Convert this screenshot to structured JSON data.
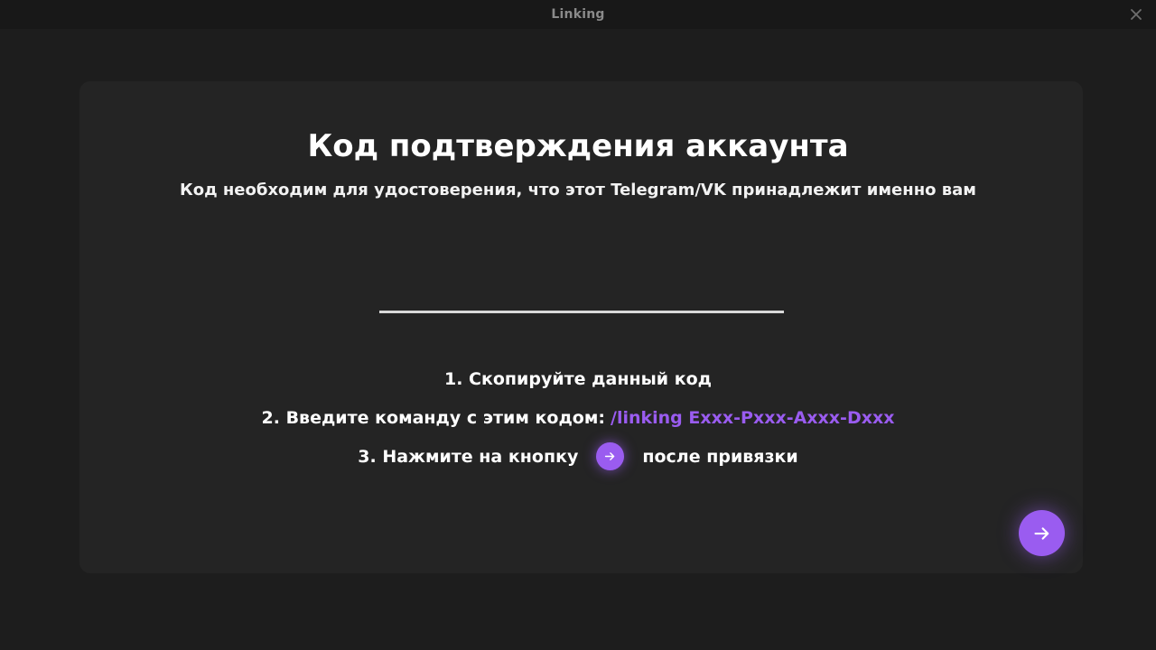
{
  "window": {
    "title": "Linking"
  },
  "card": {
    "heading": "Код подтверждения аккаунта",
    "subheading": "Код необходим для удостоверения, что этот Telegram/VK принадлежит именно вам",
    "code_field": {
      "value": "",
      "placeholder": ""
    },
    "steps": {
      "step1": "1. Скопируйте данный код",
      "step2_text": "2. Введите команду с этим кодом:",
      "step2_command": "/linking Exxx-Pxxx-Axxx-Dxxx",
      "step3_before": "3. Нажмите на кнопку",
      "step3_after": "после привязки"
    }
  },
  "icons": {
    "close": "close-icon",
    "arrow": "arrow-right-icon"
  },
  "colors": {
    "accent": "#9a5cf0",
    "background": "#1d1d1d",
    "card": "#242424",
    "titlebar": "#181818"
  }
}
